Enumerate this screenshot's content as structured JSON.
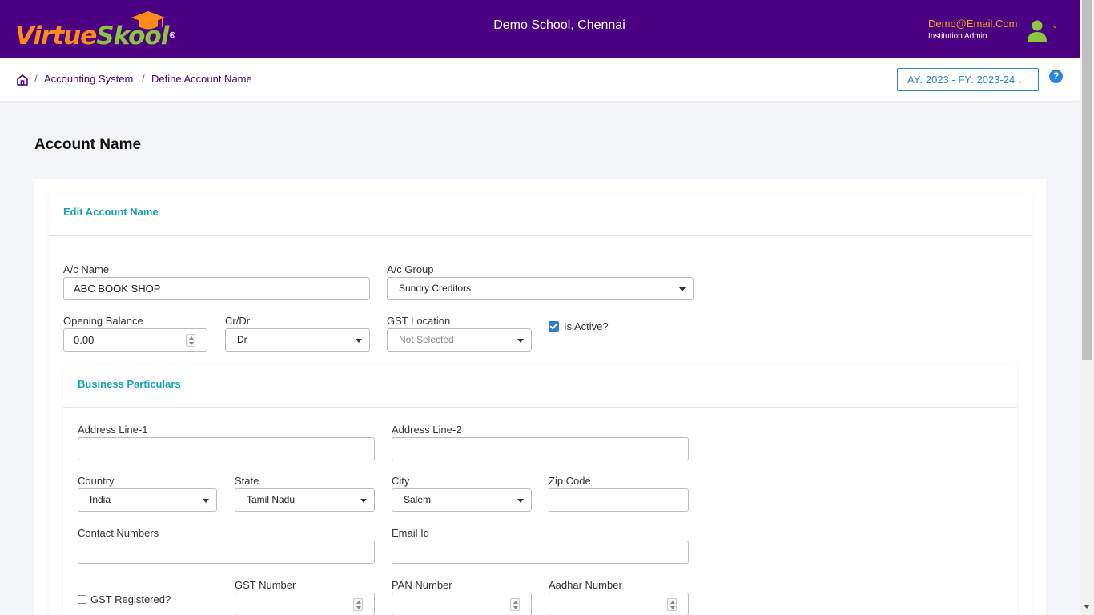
{
  "header": {
    "logo_primary": "Virtue",
    "logo_secondary": "Skool",
    "logo_mark": "®",
    "school_name": "Demo School, Chennai",
    "user_email": "Demo@Email.Com",
    "user_role": "Institution Admin",
    "colors": {
      "background": "#4b0082",
      "accent_orange": "#ff8c1a",
      "accent_green": "#8cc63f"
    }
  },
  "breadcrumb": {
    "items": [
      "Accounting System",
      "Define Account Name"
    ],
    "separator": "/"
  },
  "year_selector": {
    "label": "AY: 2023 - FY: 2023-24"
  },
  "help": {
    "glyph": "?"
  },
  "page": {
    "title": "Account Name"
  },
  "edit_section": {
    "title": "Edit Account Name",
    "ac_name": {
      "label": "A/c Name",
      "value": "ABC BOOK SHOP"
    },
    "ac_group": {
      "label": "A/c Group",
      "value": "Sundry Creditors"
    },
    "opening_balance": {
      "label": "Opening Balance",
      "value": "0.00"
    },
    "cr_dr": {
      "label": "Cr/Dr",
      "value": "Dr"
    },
    "gst_location": {
      "label": "GST Location",
      "value": "Not Selected"
    },
    "is_active": {
      "label": "Is Active?",
      "checked": true
    }
  },
  "business_section": {
    "title": "Business Particulars",
    "address1": {
      "label": "Address Line-1",
      "value": ""
    },
    "address2": {
      "label": "Address Line-2",
      "value": ""
    },
    "country": {
      "label": "Country",
      "value": "India"
    },
    "state": {
      "label": "State",
      "value": "Tamil Nadu"
    },
    "city": {
      "label": "City",
      "value": "Salem"
    },
    "zip": {
      "label": "Zip Code",
      "value": ""
    },
    "contact": {
      "label": "Contact Numbers",
      "value": ""
    },
    "email": {
      "label": "Email Id",
      "value": ""
    },
    "gst_registered": {
      "label": "GST Registered?",
      "checked": false
    },
    "gst_number": {
      "label": "GST Number",
      "value": ""
    },
    "pan_number": {
      "label": "PAN Number",
      "value": ""
    },
    "aadhar_number": {
      "label": "Aadhar Number",
      "value": ""
    }
  }
}
